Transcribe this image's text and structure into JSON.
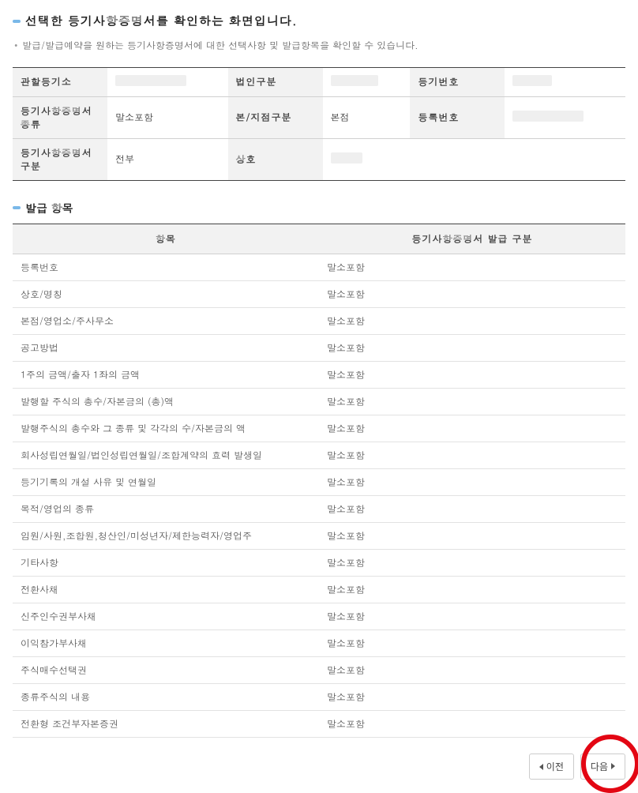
{
  "header": {
    "title": "선택한 등기사항증명서를 확인하는 화면입니다.",
    "subtitle": "발급/발급예약을 원하는 등기사항증명서에 대한 선택사항 및 발급항목을 확인할 수 있습니다."
  },
  "info": {
    "labels": {
      "office": "관할등기소",
      "corp_type": "법인구분",
      "reg_no": "등기번호",
      "cert_type": "등기사항증명서종류",
      "branch_type": "본/지점구분",
      "record_no": "등록번호",
      "cert_class": "등기사항증명서구분",
      "company": "상호"
    },
    "values": {
      "office": "",
      "corp_type": "",
      "reg_no": "",
      "cert_type": "말소포함",
      "branch_type": "본점",
      "record_no": "",
      "cert_class": "전부",
      "company": ""
    }
  },
  "issue_section_title": "발급 항목",
  "issue_table": {
    "headers": {
      "item": "항목",
      "class": "등기사항증명서 발급 구분"
    },
    "rows": [
      {
        "item": "등록번호",
        "class": "말소포함"
      },
      {
        "item": "상호/명칭",
        "class": "말소포함"
      },
      {
        "item": "본점/영업소/주사무소",
        "class": "말소포함"
      },
      {
        "item": "공고방법",
        "class": "말소포함"
      },
      {
        "item": "1주의 금액/출자 1좌의 금액",
        "class": "말소포함"
      },
      {
        "item": "발행할 주식의 총수/자본금의 (총)액",
        "class": "말소포함"
      },
      {
        "item": "발행주식의 총수와 그 종류 및 각각의 수/자본금의 액",
        "class": "말소포함"
      },
      {
        "item": "회사성립연월일/법인성립연월일/조합계약의 효력 발생일",
        "class": "말소포함"
      },
      {
        "item": "등기기록의 개설 사유 및 연월일",
        "class": "말소포함"
      },
      {
        "item": "목적/영업의 종류",
        "class": "말소포함"
      },
      {
        "item": "임원/사원,조합원,청산인/미성년자/제한능력자/영업주",
        "class": "말소포함"
      },
      {
        "item": "기타사항",
        "class": "말소포함"
      },
      {
        "item": "전환사채",
        "class": "말소포함"
      },
      {
        "item": "신주인수권부사채",
        "class": "말소포함"
      },
      {
        "item": "이익참가부사채",
        "class": "말소포함"
      },
      {
        "item": "주식매수선택권",
        "class": "말소포함"
      },
      {
        "item": "종류주식의 내용",
        "class": "말소포함"
      },
      {
        "item": "전환형 조건부자본증권",
        "class": "말소포함"
      }
    ]
  },
  "buttons": {
    "prev": "이전",
    "next": "다음"
  }
}
